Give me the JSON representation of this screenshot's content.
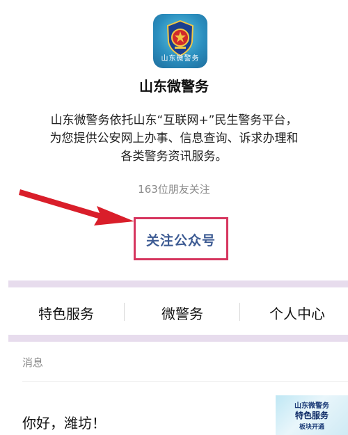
{
  "account": {
    "name": "山东微警务",
    "avatar_caption": "山东微警务",
    "description_lines": [
      "山东微警务依托山东“互联网+”民生警务平台，",
      "为您提供公安网上办事、信息查询、诉求办理和",
      "各类警务资讯服务。"
    ],
    "followers_text": "163位朋友关注",
    "follow_button_label": "关注公众号"
  },
  "menu": {
    "items": [
      {
        "label": "特色服务"
      },
      {
        "label": "微警务"
      },
      {
        "label": "个人中心"
      }
    ]
  },
  "messages": {
    "section_label": "消息",
    "greeting": "你好，潍坊！",
    "thumbnail": {
      "line1": "山东微警务",
      "line2": "特色服务",
      "line3": "板块开通"
    }
  },
  "colors": {
    "highlight_border": "#d6365f",
    "arrow": "#d91e2a",
    "follow_text": "#3d5b93",
    "band": "#e7dced",
    "avatar_bg": "#2b8fbf"
  },
  "icons": {
    "avatar": "police-emblem-icon",
    "annotation": "red-arrow-icon"
  }
}
